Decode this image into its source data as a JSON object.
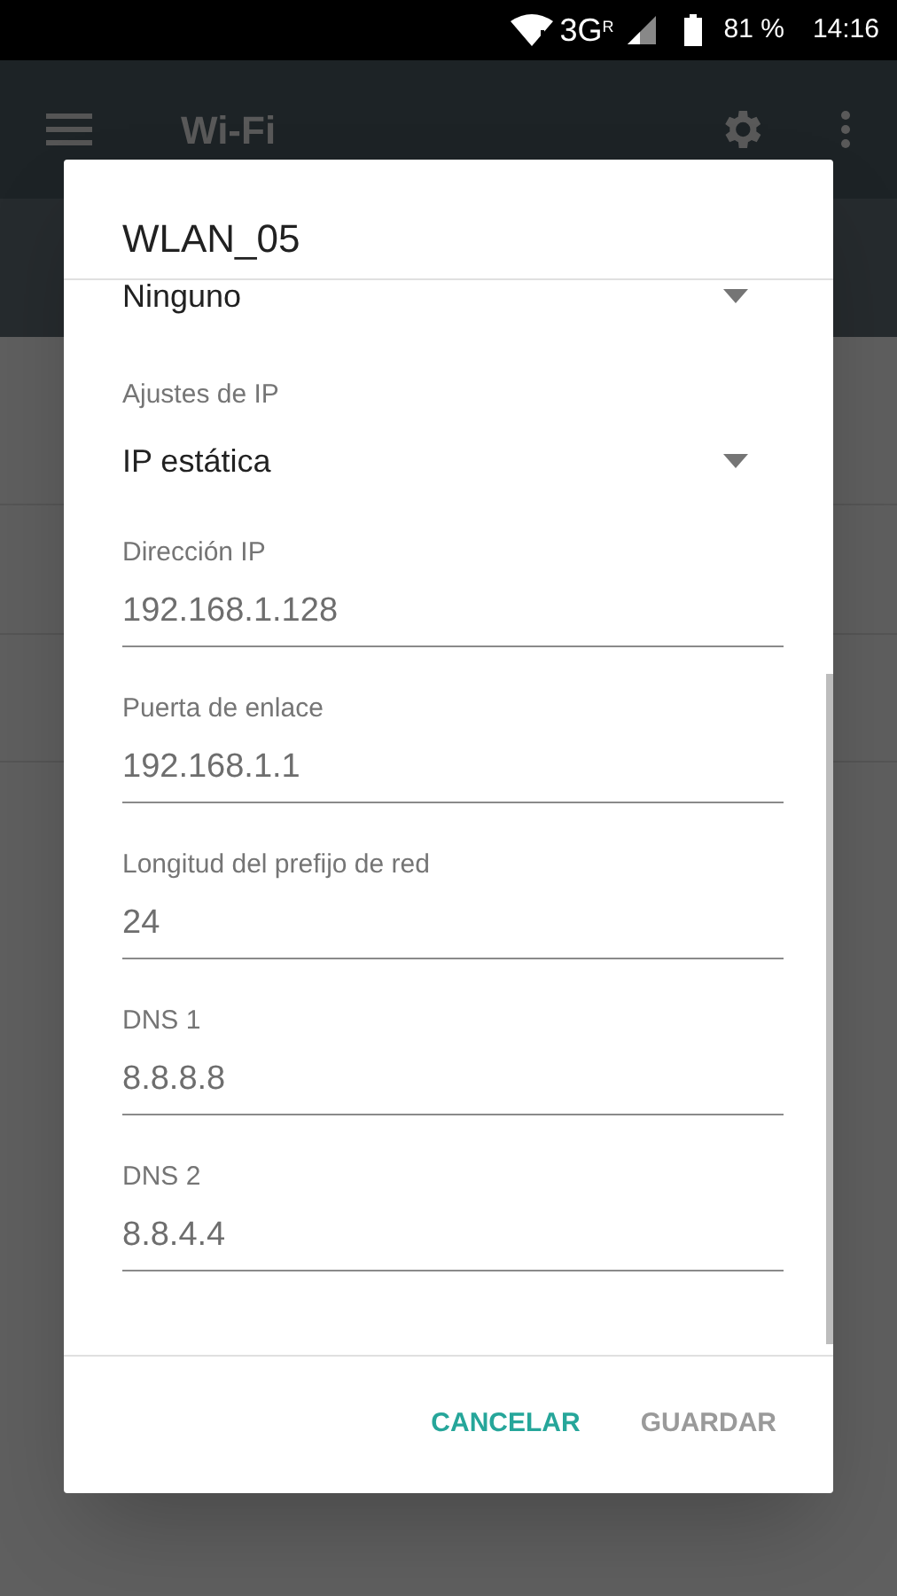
{
  "status_bar": {
    "network": "3G",
    "roaming": "R",
    "battery": "81 %",
    "time": "14:16"
  },
  "app_bar": {
    "title": "Wi-Fi"
  },
  "dialog": {
    "title": "WLAN_05",
    "fields": [
      {
        "kind": "dropdown",
        "value": "Ninguno"
      },
      {
        "kind": "dropdown",
        "label": "Ajustes de IP",
        "value": "IP estática"
      },
      {
        "kind": "text",
        "label": "Dirección IP",
        "value": "192.168.1.128"
      },
      {
        "kind": "text",
        "label": "Puerta de enlace",
        "value": "192.168.1.1"
      },
      {
        "kind": "text",
        "label": "Longitud del prefijo de red",
        "value": "24"
      },
      {
        "kind": "text",
        "label": "DNS 1",
        "value": "8.8.8.8"
      },
      {
        "kind": "text",
        "label": "DNS 2",
        "value": "8.8.4.4"
      }
    ],
    "buttons": [
      {
        "label": "CANCELAR",
        "disabled": false
      },
      {
        "label": "GUARDAR",
        "disabled": true
      }
    ]
  }
}
